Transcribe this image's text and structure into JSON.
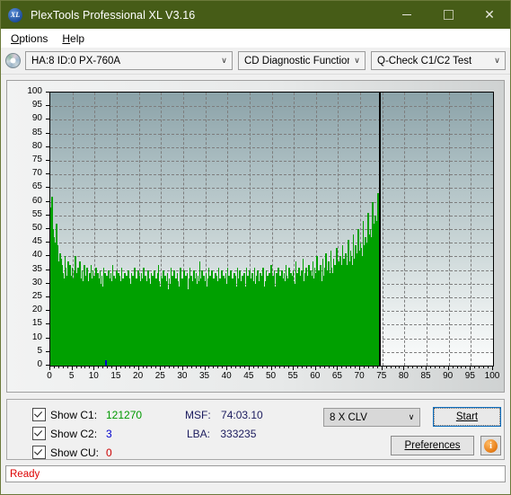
{
  "window": {
    "title": "PlexTools Professional XL V3.16",
    "app_icon": "xl-logo-icon",
    "minimize_label": "minimize-icon",
    "maximize_label": "maximize-icon",
    "close_label": "✕",
    "titlebar_color": "#465c17"
  },
  "menu": {
    "items": [
      {
        "label": "Options",
        "mnemonic": "O"
      },
      {
        "label": "Help",
        "mnemonic": "H"
      }
    ]
  },
  "toolbar": {
    "disc_icon": "disc-icon",
    "drive": {
      "value": "HA:8 ID:0  PX-760A",
      "arrow": "∨"
    },
    "function": {
      "value": "CD Diagnostic Functions",
      "arrow": "∨"
    },
    "test": {
      "value": "Q-Check C1/C2 Test",
      "arrow": "∨"
    }
  },
  "chart_data": {
    "type": "bar",
    "title": "",
    "xlabel": "",
    "ylabel": "",
    "xlim": [
      0,
      100
    ],
    "ylim": [
      0,
      100
    ],
    "xticks": [
      0,
      5,
      10,
      15,
      20,
      25,
      30,
      35,
      40,
      45,
      50,
      55,
      60,
      65,
      70,
      75,
      80,
      85,
      90,
      95,
      100
    ],
    "yticks": [
      0,
      5,
      10,
      15,
      20,
      25,
      30,
      35,
      40,
      45,
      50,
      55,
      60,
      65,
      70,
      75,
      80,
      85,
      90,
      95,
      100
    ],
    "grid": true,
    "legend": "none",
    "cursor_x": 74.2,
    "series": [
      {
        "name": "C1",
        "color": "#00a000",
        "x_start": 0,
        "x_end": 74.2,
        "values": [
          58,
          62,
          56,
          50,
          47,
          41,
          45,
          52,
          44,
          38,
          36,
          41,
          35,
          39,
          37,
          34,
          32,
          40,
          36,
          33,
          31,
          38,
          34,
          37,
          33,
          30,
          36,
          32,
          35,
          31,
          40,
          34,
          30,
          36,
          33,
          38,
          32,
          29,
          35,
          31,
          34,
          37,
          30,
          33,
          36,
          31,
          28,
          34,
          30,
          37,
          32,
          35,
          29,
          33,
          31,
          36,
          30,
          34,
          28,
          32,
          35,
          30,
          33,
          29,
          36,
          31,
          34,
          28,
          33,
          30,
          35,
          32,
          29,
          34,
          31,
          37,
          30,
          33,
          28,
          32,
          35,
          30,
          34,
          29,
          33,
          31,
          36,
          28,
          32,
          30,
          34,
          29,
          33,
          31,
          35,
          28,
          32,
          30,
          34,
          29,
          33,
          31,
          36,
          29,
          32,
          30,
          35,
          28,
          33,
          31,
          34,
          29,
          32,
          36,
          30,
          33,
          28,
          31,
          35,
          29,
          32,
          30,
          34,
          28,
          33,
          31,
          35,
          29,
          32,
          30,
          34,
          37,
          31,
          29,
          33,
          28,
          32,
          35,
          30,
          33,
          31,
          29,
          34,
          28,
          32,
          30,
          36,
          31,
          33,
          29,
          35,
          28,
          32,
          30,
          34,
          31,
          29,
          33,
          36,
          28,
          32,
          30,
          35,
          31,
          33,
          29,
          34,
          28,
          32,
          36,
          30,
          33,
          31,
          29,
          35,
          28,
          32,
          34,
          30,
          33,
          31,
          38,
          29,
          32,
          35,
          28,
          33,
          31,
          30,
          34,
          29,
          32,
          36,
          28,
          33,
          31,
          35,
          30,
          32,
          29,
          34,
          28,
          33,
          31,
          36,
          30,
          32,
          29,
          35,
          31,
          33,
          28,
          32,
          34,
          30,
          36,
          29,
          33,
          31,
          35,
          30,
          32,
          28,
          34,
          31,
          33,
          29,
          36,
          30,
          32,
          35,
          31,
          28,
          33,
          30,
          34,
          32,
          29,
          36,
          31,
          33,
          30,
          35,
          28,
          32,
          34,
          31,
          29,
          36,
          30,
          33,
          32,
          35,
          31,
          28,
          34,
          30,
          33,
          36,
          32,
          29,
          31,
          35,
          30,
          33,
          28,
          34,
          32,
          37,
          30,
          33,
          31,
          35,
          29,
          32,
          34,
          30,
          36,
          31,
          33,
          29,
          35,
          32,
          30,
          34,
          31,
          37,
          33,
          30,
          32,
          36,
          31,
          34,
          29,
          33,
          35,
          31,
          30,
          38,
          32,
          34,
          31,
          36,
          33,
          30,
          35,
          32,
          39,
          31,
          34,
          30,
          36,
          33,
          32,
          37,
          31,
          35,
          33,
          30,
          38,
          32,
          36,
          34,
          31,
          40,
          33,
          35,
          32,
          37,
          34,
          31,
          39,
          33,
          36,
          32,
          41,
          35,
          33,
          38,
          34,
          32,
          42,
          36,
          34,
          39,
          33,
          37,
          35,
          43,
          32,
          38,
          36,
          40,
          34,
          37,
          44,
          35,
          39,
          33,
          41,
          37,
          35,
          46,
          38,
          36,
          42,
          40,
          37,
          48,
          39,
          36,
          44,
          41,
          38,
          50,
          42,
          39,
          45,
          43,
          40,
          53,
          44,
          41,
          47,
          45,
          42,
          56,
          48,
          44,
          50,
          47,
          45,
          60,
          52,
          48,
          55,
          50,
          53,
          63,
          58
        ]
      },
      {
        "name": "C2",
        "color": "#0000cc",
        "spikes": [
          {
            "x": 12.4,
            "value": 2
          }
        ]
      },
      {
        "name": "CU",
        "color": "#cc0000",
        "spikes": []
      }
    ]
  },
  "stats": {
    "checkboxes": [
      {
        "label": "Show C1:",
        "value": "121270",
        "color_class": "v-c1",
        "checked": true
      },
      {
        "label": "Show C2:",
        "value": "3",
        "color_class": "v-c2",
        "checked": true
      },
      {
        "label": "Show CU:",
        "value": "0",
        "color_class": "v-cu",
        "checked": true
      }
    ],
    "msf_key": "MSF:",
    "msf_value": "74:03.10",
    "lba_key": "LBA:",
    "lba_value": "333235",
    "speed": {
      "value": "8 X CLV",
      "arrow": "∨"
    },
    "start_label": "Start",
    "preferences_label": "Preferences",
    "info_label": "i"
  },
  "statusbar": {
    "text": "Ready",
    "color": "#dd0000"
  }
}
